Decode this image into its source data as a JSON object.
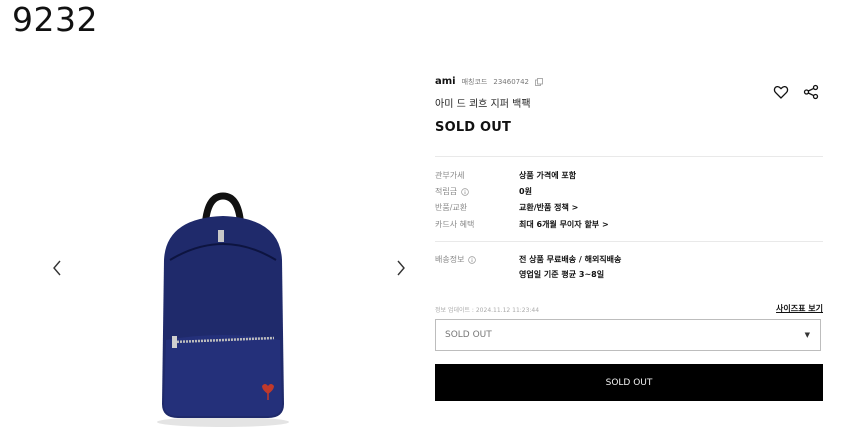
{
  "corner_id": "9232",
  "gallery": {
    "prev_icon": "chevron-left-icon",
    "next_icon": "chevron-right-icon",
    "image_alt": "navy blue backpack"
  },
  "product": {
    "brand": "ami",
    "code_label": "매칭코드",
    "code_value": "23460742",
    "name": "아미 드 쾨흐 지퍼 백팩",
    "status": "SOLD OUT"
  },
  "details": [
    {
      "label": "관부가세",
      "value": "상품 가격에 포함",
      "has_info": false
    },
    {
      "label": "적립금",
      "value": "0원",
      "has_info": true
    },
    {
      "label": "반품/교환",
      "value": "교환/반품 정책 >",
      "has_info": false
    },
    {
      "label": "카드사 혜택",
      "value": "최대 6개월 무이자 할부 >",
      "has_info": false
    }
  ],
  "shipping": {
    "label": "배송정보",
    "line1": "전 상품 무료배송 / 해외직배송",
    "line2": "영업일 기준 평균 3~8일"
  },
  "update_note": "정보 업데이트 : 2024.11.12 11:23:44",
  "size_guide": "사이즈표 보기",
  "option_select": {
    "value": "SOLD OUT"
  },
  "buy_button": "SOLD OUT",
  "colors": {
    "bag": "#1f2a6b",
    "button_bg": "#000000"
  }
}
